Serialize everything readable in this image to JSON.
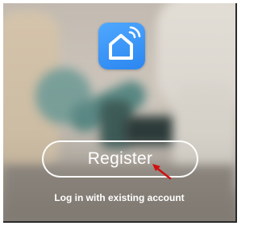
{
  "app": {
    "icon": "smart-home-house-wifi-icon",
    "icon_color": "#2b86f0"
  },
  "actions": {
    "register_label": "Register",
    "login_label": "Log in with existing account"
  },
  "annotation": {
    "pointer_color": "#d01010"
  }
}
